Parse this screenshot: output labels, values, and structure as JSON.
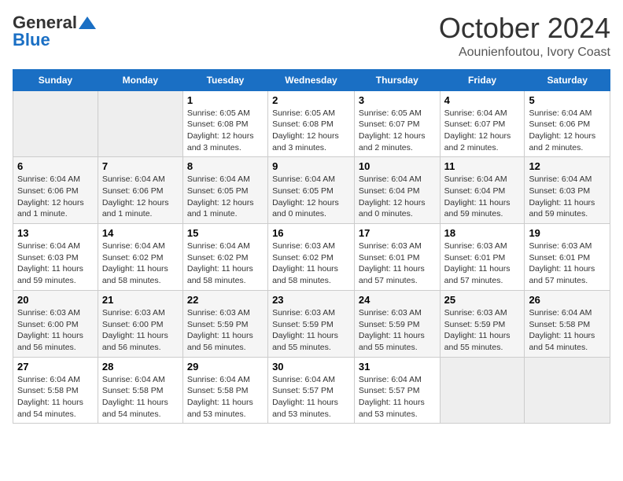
{
  "header": {
    "logo_general": "General",
    "logo_blue": "Blue",
    "title": "October 2024",
    "subtitle": "Aounienfoutou, Ivory Coast"
  },
  "weekdays": [
    "Sunday",
    "Monday",
    "Tuesday",
    "Wednesday",
    "Thursday",
    "Friday",
    "Saturday"
  ],
  "weeks": [
    [
      {
        "day": "",
        "info": ""
      },
      {
        "day": "",
        "info": ""
      },
      {
        "day": "1",
        "info": "Sunrise: 6:05 AM\nSunset: 6:08 PM\nDaylight: 12 hours\nand 3 minutes."
      },
      {
        "day": "2",
        "info": "Sunrise: 6:05 AM\nSunset: 6:08 PM\nDaylight: 12 hours\nand 3 minutes."
      },
      {
        "day": "3",
        "info": "Sunrise: 6:05 AM\nSunset: 6:07 PM\nDaylight: 12 hours\nand 2 minutes."
      },
      {
        "day": "4",
        "info": "Sunrise: 6:04 AM\nSunset: 6:07 PM\nDaylight: 12 hours\nand 2 minutes."
      },
      {
        "day": "5",
        "info": "Sunrise: 6:04 AM\nSunset: 6:06 PM\nDaylight: 12 hours\nand 2 minutes."
      }
    ],
    [
      {
        "day": "6",
        "info": "Sunrise: 6:04 AM\nSunset: 6:06 PM\nDaylight: 12 hours\nand 1 minute."
      },
      {
        "day": "7",
        "info": "Sunrise: 6:04 AM\nSunset: 6:06 PM\nDaylight: 12 hours\nand 1 minute."
      },
      {
        "day": "8",
        "info": "Sunrise: 6:04 AM\nSunset: 6:05 PM\nDaylight: 12 hours\nand 1 minute."
      },
      {
        "day": "9",
        "info": "Sunrise: 6:04 AM\nSunset: 6:05 PM\nDaylight: 12 hours\nand 0 minutes."
      },
      {
        "day": "10",
        "info": "Sunrise: 6:04 AM\nSunset: 6:04 PM\nDaylight: 12 hours\nand 0 minutes."
      },
      {
        "day": "11",
        "info": "Sunrise: 6:04 AM\nSunset: 6:04 PM\nDaylight: 11 hours\nand 59 minutes."
      },
      {
        "day": "12",
        "info": "Sunrise: 6:04 AM\nSunset: 6:03 PM\nDaylight: 11 hours\nand 59 minutes."
      }
    ],
    [
      {
        "day": "13",
        "info": "Sunrise: 6:04 AM\nSunset: 6:03 PM\nDaylight: 11 hours\nand 59 minutes."
      },
      {
        "day": "14",
        "info": "Sunrise: 6:04 AM\nSunset: 6:02 PM\nDaylight: 11 hours\nand 58 minutes."
      },
      {
        "day": "15",
        "info": "Sunrise: 6:04 AM\nSunset: 6:02 PM\nDaylight: 11 hours\nand 58 minutes."
      },
      {
        "day": "16",
        "info": "Sunrise: 6:03 AM\nSunset: 6:02 PM\nDaylight: 11 hours\nand 58 minutes."
      },
      {
        "day": "17",
        "info": "Sunrise: 6:03 AM\nSunset: 6:01 PM\nDaylight: 11 hours\nand 57 minutes."
      },
      {
        "day": "18",
        "info": "Sunrise: 6:03 AM\nSunset: 6:01 PM\nDaylight: 11 hours\nand 57 minutes."
      },
      {
        "day": "19",
        "info": "Sunrise: 6:03 AM\nSunset: 6:01 PM\nDaylight: 11 hours\nand 57 minutes."
      }
    ],
    [
      {
        "day": "20",
        "info": "Sunrise: 6:03 AM\nSunset: 6:00 PM\nDaylight: 11 hours\nand 56 minutes."
      },
      {
        "day": "21",
        "info": "Sunrise: 6:03 AM\nSunset: 6:00 PM\nDaylight: 11 hours\nand 56 minutes."
      },
      {
        "day": "22",
        "info": "Sunrise: 6:03 AM\nSunset: 5:59 PM\nDaylight: 11 hours\nand 56 minutes."
      },
      {
        "day": "23",
        "info": "Sunrise: 6:03 AM\nSunset: 5:59 PM\nDaylight: 11 hours\nand 55 minutes."
      },
      {
        "day": "24",
        "info": "Sunrise: 6:03 AM\nSunset: 5:59 PM\nDaylight: 11 hours\nand 55 minutes."
      },
      {
        "day": "25",
        "info": "Sunrise: 6:03 AM\nSunset: 5:59 PM\nDaylight: 11 hours\nand 55 minutes."
      },
      {
        "day": "26",
        "info": "Sunrise: 6:04 AM\nSunset: 5:58 PM\nDaylight: 11 hours\nand 54 minutes."
      }
    ],
    [
      {
        "day": "27",
        "info": "Sunrise: 6:04 AM\nSunset: 5:58 PM\nDaylight: 11 hours\nand 54 minutes."
      },
      {
        "day": "28",
        "info": "Sunrise: 6:04 AM\nSunset: 5:58 PM\nDaylight: 11 hours\nand 54 minutes."
      },
      {
        "day": "29",
        "info": "Sunrise: 6:04 AM\nSunset: 5:58 PM\nDaylight: 11 hours\nand 53 minutes."
      },
      {
        "day": "30",
        "info": "Sunrise: 6:04 AM\nSunset: 5:57 PM\nDaylight: 11 hours\nand 53 minutes."
      },
      {
        "day": "31",
        "info": "Sunrise: 6:04 AM\nSunset: 5:57 PM\nDaylight: 11 hours\nand 53 minutes."
      },
      {
        "day": "",
        "info": ""
      },
      {
        "day": "",
        "info": ""
      }
    ]
  ]
}
